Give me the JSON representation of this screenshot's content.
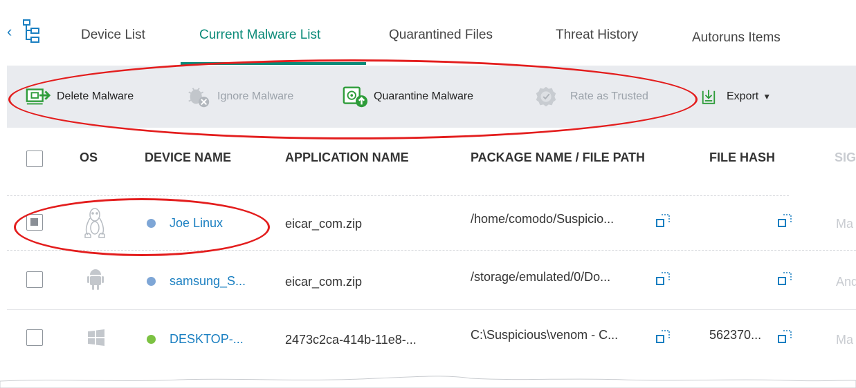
{
  "tabs": [
    {
      "label": "Device List",
      "active": false
    },
    {
      "label": "Current Malware List",
      "active": true
    },
    {
      "label": "Quarantined Files",
      "active": false
    },
    {
      "label": "Threat History",
      "active": false
    },
    {
      "label": "Autoruns Items",
      "active": false
    }
  ],
  "toolbar": {
    "delete": {
      "label": "Delete Malware",
      "icon": "delete-malware-icon",
      "enabled": true
    },
    "ignore": {
      "label": "Ignore Malware",
      "icon": "ignore-malware-icon",
      "enabled": false
    },
    "quarantine": {
      "label": "Quarantine Malware",
      "icon": "quarantine-malware-icon",
      "enabled": true
    },
    "trust": {
      "label": "Rate as Trusted",
      "icon": "rate-trusted-icon",
      "enabled": false
    },
    "export": {
      "label": "Export",
      "icon": "export-icon",
      "enabled": true
    }
  },
  "columns": [
    "OS",
    "DEVICE NAME",
    "APPLICATION NAME",
    "PACKAGE NAME / FILE PATH",
    "FILE HASH",
    "SIG"
  ],
  "rows": [
    {
      "checked": true,
      "os": "linux",
      "status_color": "#7ea6d6",
      "device": "Joe Linux",
      "app": "eicar_com.zip",
      "path": "/home/comodo/Suspicio...",
      "hash": "",
      "sig": "Ma"
    },
    {
      "checked": false,
      "os": "android",
      "status_color": "#7ea6d6",
      "device": "samsung_S...",
      "app": "eicar_com.zip",
      "path": "/storage/emulated/0/Do...",
      "hash": "",
      "sig": "And"
    },
    {
      "checked": false,
      "os": "windows",
      "status_color": "#7cc242",
      "device": "DESKTOP-...",
      "app": "2473c2ca-414b-11e8-...",
      "path": "C:\\Suspicious\\venom - C...",
      "hash": "562370...",
      "sig": "Ma"
    }
  ],
  "colors": {
    "accent": "#0a8a78",
    "link": "#1a7fc1",
    "annotation": "#e31d1d"
  }
}
